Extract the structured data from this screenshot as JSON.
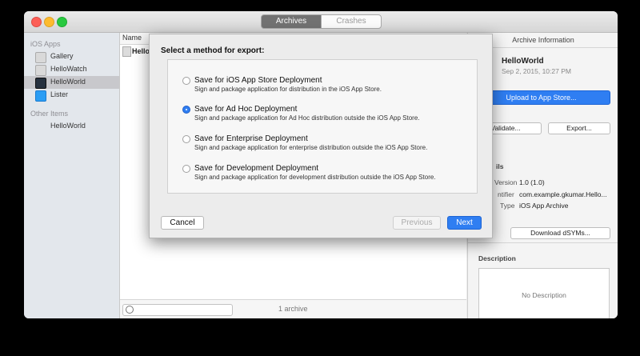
{
  "titlebar": {
    "tabs": [
      {
        "label": "Archives"
      },
      {
        "label": "Crashes"
      }
    ]
  },
  "sidebar": {
    "groups": [
      {
        "header": "iOS Apps",
        "items": [
          {
            "label": "Gallery",
            "icon": "gallery-app-icon"
          },
          {
            "label": "HelloWatch",
            "icon": "hellowatch-app-icon"
          },
          {
            "label": "HelloWorld",
            "icon": "helloworld-app-icon",
            "selected": true
          },
          {
            "label": "Lister",
            "icon": "lister-app-icon"
          }
        ]
      },
      {
        "header": "Other Items",
        "items": [
          {
            "label": "HelloWorld",
            "icon": "generic-app-icon"
          }
        ]
      }
    ]
  },
  "list": {
    "column_header": "Name",
    "rows": [
      {
        "name": "Hello"
      }
    ],
    "footer": "1 archive"
  },
  "info": {
    "header": "Archive Information",
    "app_name": "HelloWorld",
    "date": "Sep 2, 2015, 10:27 PM",
    "upload_label": "Upload to App Store...",
    "validate_label": "Validate...",
    "export_label": "Export...",
    "details_header": "ils",
    "version_label": "Version",
    "version_value": "1.0 (1.0)",
    "identifier_label": "ntifier",
    "identifier_value": "com.example.gkumar.Hello...",
    "type_label": "Type",
    "type_value": "iOS App Archive",
    "dsyms_label": "Download dSYMs...",
    "description_header": "Description",
    "description_placeholder": "No Description"
  },
  "dialog": {
    "title": "Select a method for export:",
    "options": [
      {
        "title": "Save for iOS App Store Deployment",
        "desc": "Sign and package application for distribution in the iOS App Store.",
        "selected": false
      },
      {
        "title": "Save for Ad Hoc Deployment",
        "desc": "Sign and package application for Ad Hoc distribution outside the iOS App Store.",
        "selected": true
      },
      {
        "title": "Save for Enterprise Deployment",
        "desc": "Sign and package application for enterprise distribution outside the iOS App Store.",
        "selected": false
      },
      {
        "title": "Save for Development Deployment",
        "desc": "Sign and package application for development distribution outside the iOS App Store.",
        "selected": false
      }
    ],
    "cancel_label": "Cancel",
    "previous_label": "Previous",
    "next_label": "Next"
  },
  "colors": {
    "accent": "#2f7ef2",
    "selected_row": "#c8c8cc"
  }
}
